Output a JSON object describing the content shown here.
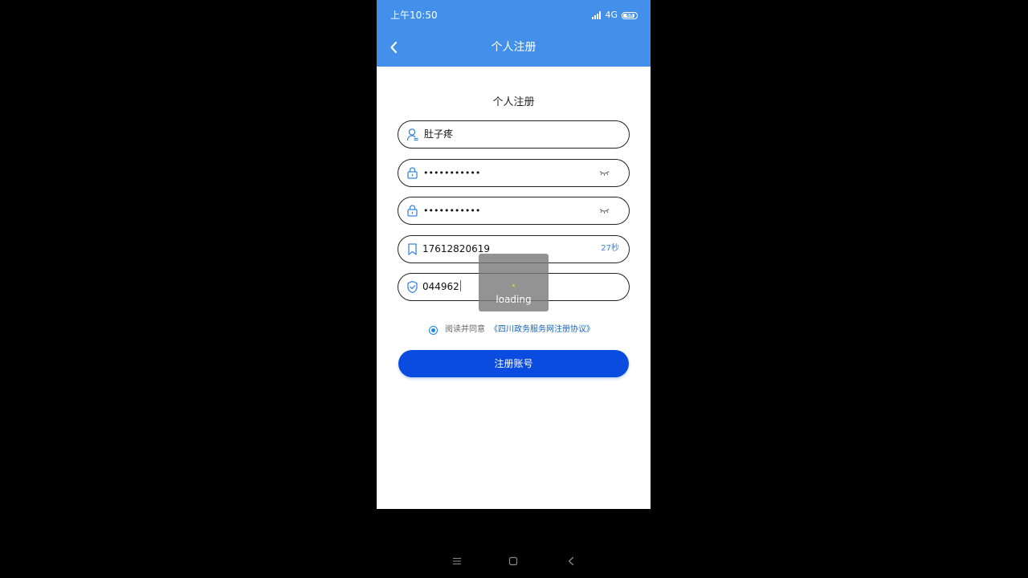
{
  "status_bar": {
    "time": "上午10:50",
    "network": "4G",
    "battery": "68"
  },
  "header": {
    "back_icon": "chevron-left-icon",
    "title": "个人注册"
  },
  "form": {
    "title": "个人注册",
    "username": {
      "icon": "user-icon",
      "value": "肚子疼"
    },
    "password": {
      "icon": "lock-icon",
      "value": "•••••••••••",
      "toggle_icon": "eye-closed-icon"
    },
    "confirm_password": {
      "icon": "lock-icon",
      "value": "•••••••••••",
      "toggle_icon": "eye-closed-icon"
    },
    "phone": {
      "icon": "bookmark-icon",
      "value": "17612820619",
      "countdown": "27秒"
    },
    "code": {
      "icon": "shield-icon",
      "value": "044962"
    }
  },
  "loading": {
    "text": "loading"
  },
  "agreement": {
    "checked": true,
    "text": "阅读并同意",
    "link": "《四川政务服务网注册协议》"
  },
  "submit": {
    "label": "注册账号"
  },
  "colors": {
    "appbar": "#4390ea",
    "primary_button": "#0a4be0",
    "link": "#1565c0",
    "accent": "#3b86e0"
  },
  "system_nav": {
    "menu_icon": "menu-icon",
    "home_icon": "square-home-icon",
    "back_icon": "triangle-back-icon"
  }
}
